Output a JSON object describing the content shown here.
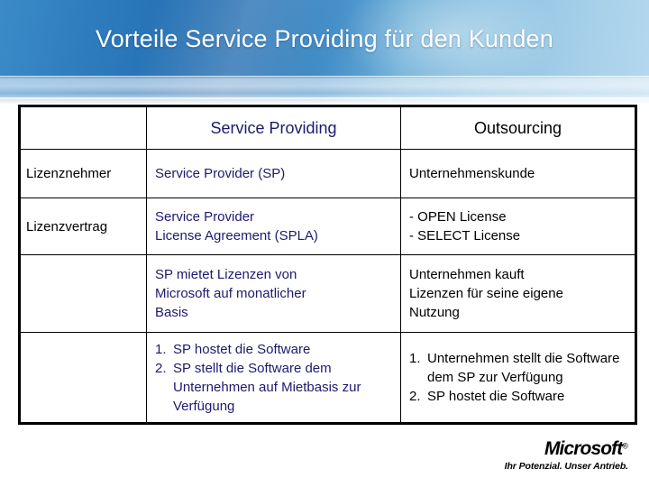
{
  "slide": {
    "title": "Vorteile Service Providing für den Kunden"
  },
  "colors": {
    "header_dark_blue": "#1f6aae",
    "header_light_blue": "#b4d8ee",
    "title_text": "#ffffff",
    "navy_text": "#1d1a6e",
    "black_text": "#000000",
    "table_border": "#000000"
  },
  "table": {
    "headers": {
      "corner": "",
      "col_service_providing": "Service Providing",
      "col_outsourcing": "Outsourcing"
    },
    "rows": [
      {
        "label": "Lizenznehmer",
        "service_providing": [
          "Service Provider (SP)"
        ],
        "outsourcing": [
          "Unternehmenskunde"
        ]
      },
      {
        "label": "Lizenzvertrag",
        "service_providing": [
          "Service Provider",
          "License Agreement (SPLA)"
        ],
        "outsourcing": [
          "- OPEN License",
          "- SELECT License"
        ]
      },
      {
        "label": "",
        "service_providing": [
          "SP mietet Lizenzen von",
          "Microsoft auf monatlicher",
          "Basis"
        ],
        "outsourcing": [
          "Unternehmen kauft",
          "Lizenzen für seine eigene",
          "Nutzung"
        ]
      },
      {
        "label": "",
        "service_providing_list": [
          {
            "num": "1.",
            "text": "SP hostet die Software"
          },
          {
            "num": "2.",
            "text": "SP stellt die Software dem Unternehmen auf Mietbasis zur Verfügung"
          }
        ],
        "outsourcing_list": [
          {
            "num": "1.",
            "text": "Unternehmen stellt die Software dem SP zur Verfügung"
          },
          {
            "num": "2.",
            "text": "SP hostet die Software"
          }
        ]
      }
    ]
  },
  "logo": {
    "wordmark": "Microsoft",
    "registered": "®",
    "tagline": "Ihr Potenzial. Unser Antrieb."
  }
}
